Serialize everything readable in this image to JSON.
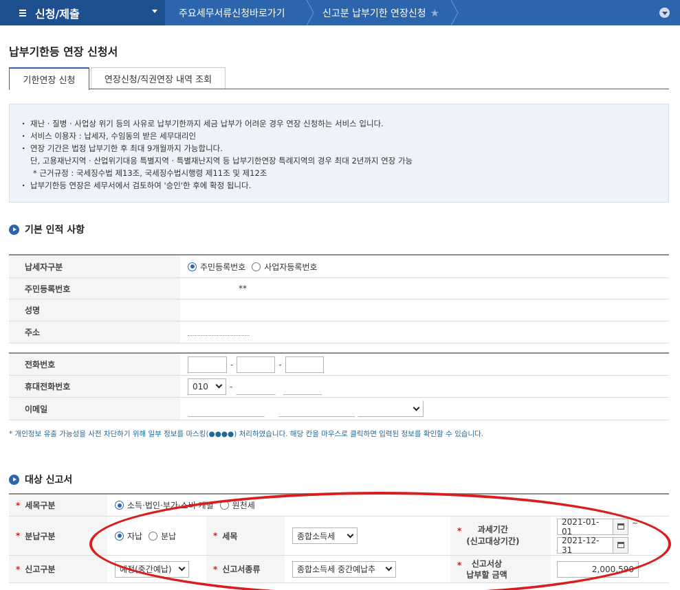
{
  "nav": {
    "menu_title": "신청/제출",
    "crumb1": "주요세무서류신청바로가기",
    "crumb2": "신고분 납부기한 연장신청",
    "star": "★"
  },
  "page_title": "납부기한등 연장 신청서",
  "tabs": [
    {
      "label": "기한연장 신청",
      "active": true
    },
    {
      "label": "연장신청/직권연장 내역 조회",
      "active": false
    }
  ],
  "notice": [
    "재난 · 질병 · 사업상 위기 등의 사유로 납부기한까지 세금 납부가 어려운 경우 연장 신청하는 서비스 입니다.",
    "서비스 이용자 : 납세자, 수임동의 받은 세무대리인",
    "연장 기간은 법정 납부기한 후 최대 9개월까지 가능합니다.",
    "단, 고용재난지역 · 산업위기대응 특별지역 · 특별재난지역 등 납부기한연장 특례지역의 경우 최대 2년까지 연장 가능",
    "* 근거규정 : 국세징수법 제13조, 국세징수법시행령 제11조 및 제12조",
    "납부기한등 연장은 세무서에서 검토하여 '승인'한 후에 확정 됩니다."
  ],
  "section1": {
    "title": "기본 인적 사항",
    "taxpayer_type_label": "납세자구분",
    "radio_resident": "주민등록번호",
    "radio_business": "사업자등록번호",
    "resident_no_label": "주민등록번호",
    "resident_no_value": "**",
    "name_label": "성명",
    "address_label": "주소",
    "phone_label": "전화번호",
    "mobile_label": "휴대전화번호",
    "mobile_prefix": "010",
    "email_label": "이메일"
  },
  "privacy_note": "* 개인정보 유출 가능성을 사전 차단하기 위해 일부 정보를 마스킹(●●●●) 처리하였습니다. 해당 칸을 마우스로 클릭하면 입력된 정보를 확인할 수 있습니다.",
  "section2": {
    "title": "대상 신고서",
    "tax_item_label": "세목구분",
    "radio_income": "소득·법인·부가·소비·개별",
    "radio_withholding": "원천세",
    "installment_label": "분납구분",
    "radio_self": "자납",
    "radio_split": "분납",
    "tax_label": "세목",
    "tax_value": "종합소득세",
    "period_label1": "과세기간",
    "period_label2": "(신고대상기간)",
    "period_from": "2021-01-01",
    "period_to": "2021-12-31",
    "period_sep": "~",
    "report_type_label": "신고구분",
    "report_type_value": "예정(중간예납)",
    "report_kind_label": "신고서종류",
    "report_kind_value": "종합소득세 중간예납추",
    "amount_label1": "신고서상",
    "amount_label2": "납부할 금액",
    "amount_value": "2,000,590",
    "required_mark": "*"
  },
  "colors": {
    "nav": "#2d65ad",
    "nav_dark": "#1e4f8f",
    "annotation": "#d81e1e"
  }
}
